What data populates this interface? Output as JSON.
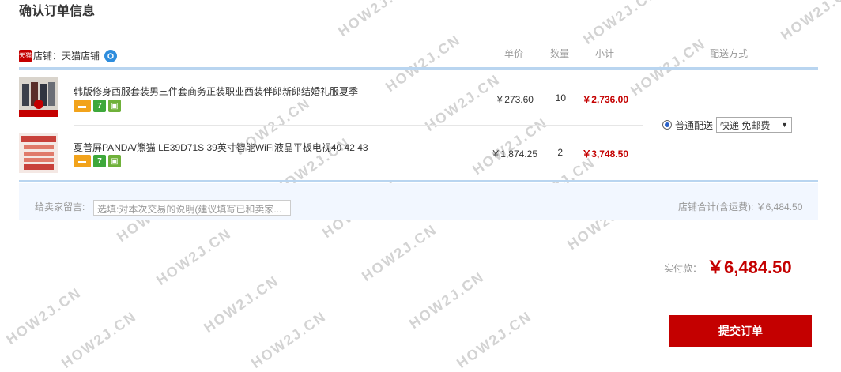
{
  "page": {
    "title": "确认订单信息"
  },
  "headers": {
    "unit_price": "单价",
    "quantity": "数量",
    "subtotal": "小计",
    "delivery": "配送方式"
  },
  "shop": {
    "label": "店铺：天猫店铺",
    "tmall_icon_text": "天猫"
  },
  "items": [
    {
      "title": "韩版修身西服套装男三件套商务正装职业西装伴郎新郎结婚礼服夏季",
      "price": "￥273.60",
      "qty": "10",
      "subtotal": "￥2,736.00",
      "badges": [
        "card-icon",
        "seven-day-icon",
        "guarantee-icon"
      ]
    },
    {
      "title": "夏普屏PANDA/熊猫 LE39D71S 39英寸智能WiFi液晶平板电视40 42 43",
      "price": "￥1,874.25",
      "qty": "2",
      "subtotal": "￥3,748.50",
      "badges": [
        "card-icon",
        "seven-day-icon",
        "guarantee-icon"
      ]
    }
  ],
  "delivery": {
    "option": "普通配送",
    "selected": "快递 免邮费"
  },
  "message": {
    "label": "给卖家留言:",
    "placeholder": "选填:对本次交易的说明(建议填写已和卖家..."
  },
  "shop_total": "店铺合计(含运费): ￥6,484.50",
  "payment": {
    "label": "实付款：",
    "amount": "￥6,484.50"
  },
  "submit_label": "提交订单",
  "watermark": "HOW2J.CN",
  "colors": {
    "accent_red": "#c40000",
    "line_blue": "#b9d5f0"
  }
}
